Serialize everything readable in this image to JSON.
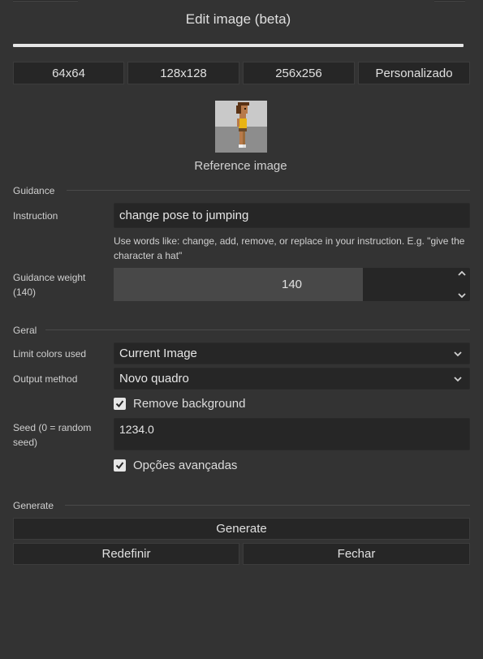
{
  "dialog": {
    "title": "Edit image (beta)"
  },
  "size_presets": [
    {
      "label": "64x64"
    },
    {
      "label": "128x128"
    },
    {
      "label": "256x256"
    },
    {
      "label": "Personalizado"
    }
  ],
  "reference": {
    "caption": "Reference image"
  },
  "guidance": {
    "section_label": "Guidance",
    "instruction_label": "Instruction",
    "instruction_value": "change pose to jumping",
    "hint": "Use words like: change, add, remove, or replace in your instruction. E.g. \"give the character a hat\"",
    "weight_label": "Guidance weight (140)",
    "weight_value": "140",
    "weight_fill_fraction": 0.7
  },
  "geral": {
    "section_label": "Geral",
    "limit_colors_label": "Limit colors used",
    "limit_colors_value": "Current Image",
    "output_method_label": "Output method",
    "output_method_value": "Novo quadro",
    "remove_background_label": "Remove background",
    "remove_background_checked": true,
    "seed_label": "Seed (0 = random seed)",
    "seed_value": "1234.0",
    "advanced_label": "Opções avançadas",
    "advanced_checked": true
  },
  "generate": {
    "section_label": "Generate",
    "generate_label": "Generate",
    "reset_label": "Redefinir",
    "close_label": "Fechar"
  },
  "colors": {
    "background": "#333333",
    "input": "#262626",
    "slider_fill": "#484848",
    "accent_rule": "#e6e6e6"
  }
}
